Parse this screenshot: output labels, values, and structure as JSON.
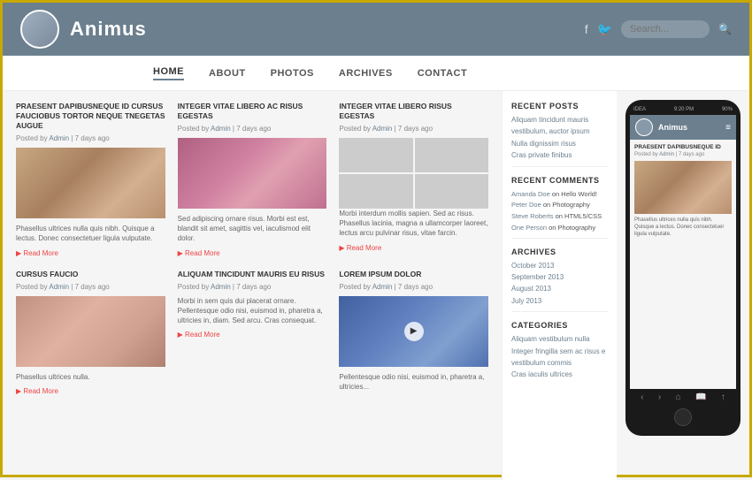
{
  "header": {
    "title": "Animus",
    "search_placeholder": "Search..."
  },
  "nav": {
    "items": [
      {
        "label": "HOME",
        "active": true
      },
      {
        "label": "ABOUT",
        "active": false
      },
      {
        "label": "PHOTOS",
        "active": false
      },
      {
        "label": "ARCHIVES",
        "active": false
      },
      {
        "label": "CONTACT",
        "active": false
      }
    ]
  },
  "posts": [
    {
      "title": "PRAESENT DAPIBUSNEQUE ID CURSUS FAUCIOBUS TORTOR NEQUE TNEGETAS AUGUE",
      "meta_prefix": "Posted by",
      "author": "Admin",
      "date": "7 days ago",
      "text": "Phasellus ultrices nulla quis nibh. Quisque a lectus. Donec consectetuer ligula vulputate.",
      "img_class": "img-woman1"
    },
    {
      "title": "INTEGER VITAE LIBERO AC RISUS EGESTAS",
      "meta_prefix": "Posted by",
      "author": "Admin",
      "date": "7 days ago",
      "text": "Sed adipiscing ornare risus. Morbi est est, blandit sit amet, sagittis vel, iaculismod elit dolor.",
      "img_class": "img-woman2"
    },
    {
      "title": "INTEGER VITAE LIBERO RISUS EGESTAS",
      "meta_prefix": "Posted by",
      "author": "Admin",
      "date": "7 days ago",
      "text": "Morbi interdum mollis sapien. Sed ac risus. Phasellus lacinia, magna a ullamcorper laoreet, lectus arcu pulvinar risus, vitae farcin.",
      "img_class": "collage"
    },
    {
      "title": "CURSUS FAUCIO",
      "meta_prefix": "Posted by",
      "author": "Admin",
      "date": "7 days ago",
      "text": "Phasellus ultrices nulla.",
      "img_class": "img-woman5"
    },
    {
      "title": "ALIQUAM TINCIDUNT MAURIS EU RISUS",
      "meta_prefix": "Posted by",
      "author": "Admin",
      "date": "7 days ago",
      "text": "Morbi in sem quis dui placerat ornare. Pellentesque odio nisi, euismod in, pharetra a, ultricies in, diam. Sed arcu. Cras consequat.",
      "img_class": ""
    },
    {
      "title": "LOREM IPSUM DOLOR",
      "meta_prefix": "Posted by",
      "author": "Admin",
      "date": "7 days ago",
      "text": "Pellentesque odio nisi, euismod in, pharetra a, ultricies...",
      "img_class": "img-tech"
    }
  ],
  "sidebar": {
    "recent_posts_title": "RECENT POSTS",
    "recent_posts": [
      "Aliquam tincidunt mauris",
      "vestibulum, auctor ipsum",
      "Nulla dignissim risus",
      "Cras private finibus"
    ],
    "recent_comments_title": "RECENT COMMENTS",
    "recent_comments": [
      {
        "author": "Amanda Doe",
        "on": "on Hello World!"
      },
      {
        "author": "Peter Doe",
        "on": "on Photography"
      },
      {
        "author": "Steve Roberts",
        "on": "on HTML5/CSS"
      },
      {
        "author": "One Person",
        "on": "on Photography"
      }
    ],
    "archives_title": "ARCHIVES",
    "archives": [
      "October 2013",
      "September 2013",
      "August 2013",
      "July 2013"
    ],
    "categories_title": "CATEGORIES",
    "categories": [
      "Aliquam vestibulum nulla",
      "Integer fringilla sem ac risus e",
      "vestibulum commis",
      "Cras iaculis ultrices"
    ]
  },
  "phone": {
    "carrier": "IDEA",
    "time": "9:20 PM",
    "battery": "90%",
    "title": "Animus",
    "post_title": "PRAESENT DAPIBUSNEQUE ID",
    "post_meta_prefix": "Posted by",
    "post_author": "Admin",
    "post_date": "7 days ago",
    "post_text": "Phasellus ultrices nulla quis nibh. Quisque a lectus. Donec consectetuer ligula vulputate."
  },
  "read_more_label": "Read More"
}
